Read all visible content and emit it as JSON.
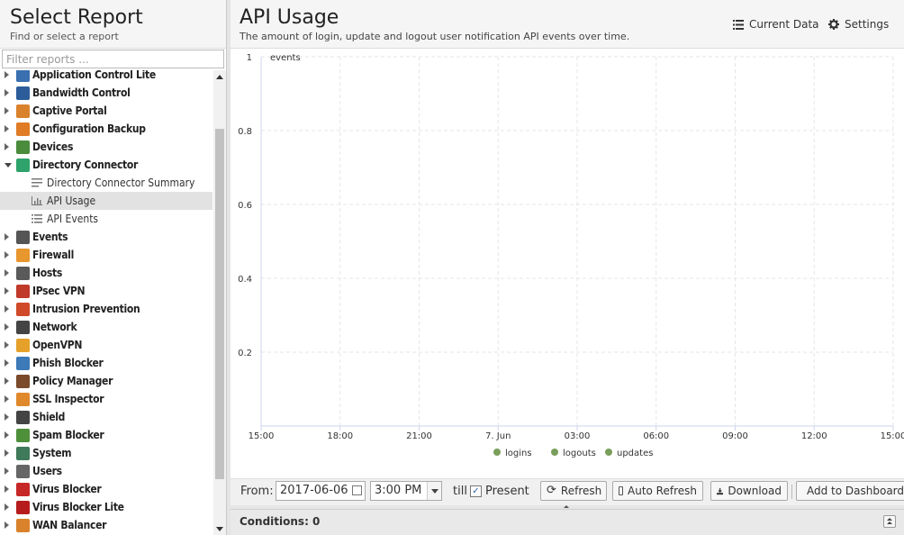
{
  "left_panel": {
    "title": "Select Report",
    "subtitle": "Find or select a report",
    "filter_placeholder": "Filter reports ...",
    "items": [
      {
        "label": "Application Control Lite",
        "type": "parent",
        "expanded": false,
        "icon": "application-control-lite-icon",
        "color": "#3a6fb0"
      },
      {
        "label": "Bandwidth Control",
        "type": "parent",
        "expanded": false,
        "icon": "bandwidth-control-icon",
        "color": "#2c5d9a"
      },
      {
        "label": "Captive Portal",
        "type": "parent",
        "expanded": false,
        "icon": "captive-portal-icon",
        "color": "#d9822b"
      },
      {
        "label": "Configuration Backup",
        "type": "parent",
        "expanded": false,
        "icon": "configuration-backup-icon",
        "color": "#e07b26"
      },
      {
        "label": "Devices",
        "type": "parent",
        "expanded": false,
        "icon": "devices-icon",
        "color": "#4a8c3b"
      },
      {
        "label": "Directory Connector",
        "type": "parent",
        "expanded": true,
        "icon": "directory-connector-icon",
        "color": "#2fa36b"
      },
      {
        "label": "Directory Connector Summary",
        "type": "child",
        "icon": "text-report-icon"
      },
      {
        "label": "API Usage",
        "type": "child",
        "icon": "bar-chart-icon",
        "selected": true
      },
      {
        "label": "API Events",
        "type": "child",
        "icon": "list-icon"
      },
      {
        "label": "Events",
        "type": "parent",
        "expanded": false,
        "icon": "events-icon",
        "color": "#555555"
      },
      {
        "label": "Firewall",
        "type": "parent",
        "expanded": false,
        "icon": "firewall-icon",
        "color": "#e8962e"
      },
      {
        "label": "Hosts",
        "type": "parent",
        "expanded": false,
        "icon": "hosts-icon",
        "color": "#5a5a5a"
      },
      {
        "label": "IPsec VPN",
        "type": "parent",
        "expanded": false,
        "icon": "ipsec-vpn-icon",
        "color": "#c0392b"
      },
      {
        "label": "Intrusion Prevention",
        "type": "parent",
        "expanded": false,
        "icon": "intrusion-prevention-icon",
        "color": "#d04a2a"
      },
      {
        "label": "Network",
        "type": "parent",
        "expanded": false,
        "icon": "network-icon",
        "color": "#444444"
      },
      {
        "label": "OpenVPN",
        "type": "parent",
        "expanded": false,
        "icon": "openvpn-icon",
        "color": "#e6a12b"
      },
      {
        "label": "Phish Blocker",
        "type": "parent",
        "expanded": false,
        "icon": "phish-blocker-icon",
        "color": "#3c7ab8"
      },
      {
        "label": "Policy Manager",
        "type": "parent",
        "expanded": false,
        "icon": "policy-manager-icon",
        "color": "#7a4a2a"
      },
      {
        "label": "SSL Inspector",
        "type": "parent",
        "expanded": false,
        "icon": "ssl-inspector-icon",
        "color": "#e0892c"
      },
      {
        "label": "Shield",
        "type": "parent",
        "expanded": false,
        "icon": "shield-icon",
        "color": "#444444"
      },
      {
        "label": "Spam Blocker",
        "type": "parent",
        "expanded": false,
        "icon": "spam-blocker-icon",
        "color": "#4e8f3a"
      },
      {
        "label": "System",
        "type": "parent",
        "expanded": false,
        "icon": "system-icon",
        "color": "#3f7a5a"
      },
      {
        "label": "Users",
        "type": "parent",
        "expanded": false,
        "icon": "users-icon",
        "color": "#666666"
      },
      {
        "label": "Virus Blocker",
        "type": "parent",
        "expanded": false,
        "icon": "virus-blocker-icon",
        "color": "#c62828"
      },
      {
        "label": "Virus Blocker Lite",
        "type": "parent",
        "expanded": false,
        "icon": "virus-blocker-lite-icon",
        "color": "#b71c1c"
      },
      {
        "label": "WAN Balancer",
        "type": "parent",
        "expanded": false,
        "icon": "wan-balancer-icon",
        "color": "#d9822b"
      }
    ]
  },
  "report": {
    "title": "API Usage",
    "description": "The amount of login, update and logout user notification API events over time.",
    "current_data_label": "Current Data",
    "settings_label": "Settings"
  },
  "chart_data": {
    "type": "line",
    "ylabel": "events",
    "ylim": [
      0,
      1
    ],
    "y_ticks": [
      "0.2",
      "0.4",
      "0.6",
      "0.8",
      "1"
    ],
    "x_ticks": [
      "15:00",
      "18:00",
      "21:00",
      "7. Jun",
      "03:00",
      "06:00",
      "09:00",
      "12:00",
      "15:00"
    ],
    "series": [
      {
        "name": "logins",
        "color": "#7a9e5b",
        "values": []
      },
      {
        "name": "logouts",
        "color": "#7a9e5b",
        "values": []
      },
      {
        "name": "updates",
        "color": "#7a9e5b",
        "values": []
      }
    ],
    "grid": true,
    "legend": "bottom"
  },
  "toolbar": {
    "from_label": "From:",
    "date_value": "2017-06-06",
    "time_value": "3:00 PM",
    "till_label": "till",
    "present_label": "Present",
    "present_checked": true,
    "refresh_label": "Refresh",
    "auto_refresh_label": "Auto Refresh",
    "download_label": "Download",
    "add_dashboard_label": "Add to Dashboard"
  },
  "conditions": {
    "label": "Conditions: 0"
  }
}
